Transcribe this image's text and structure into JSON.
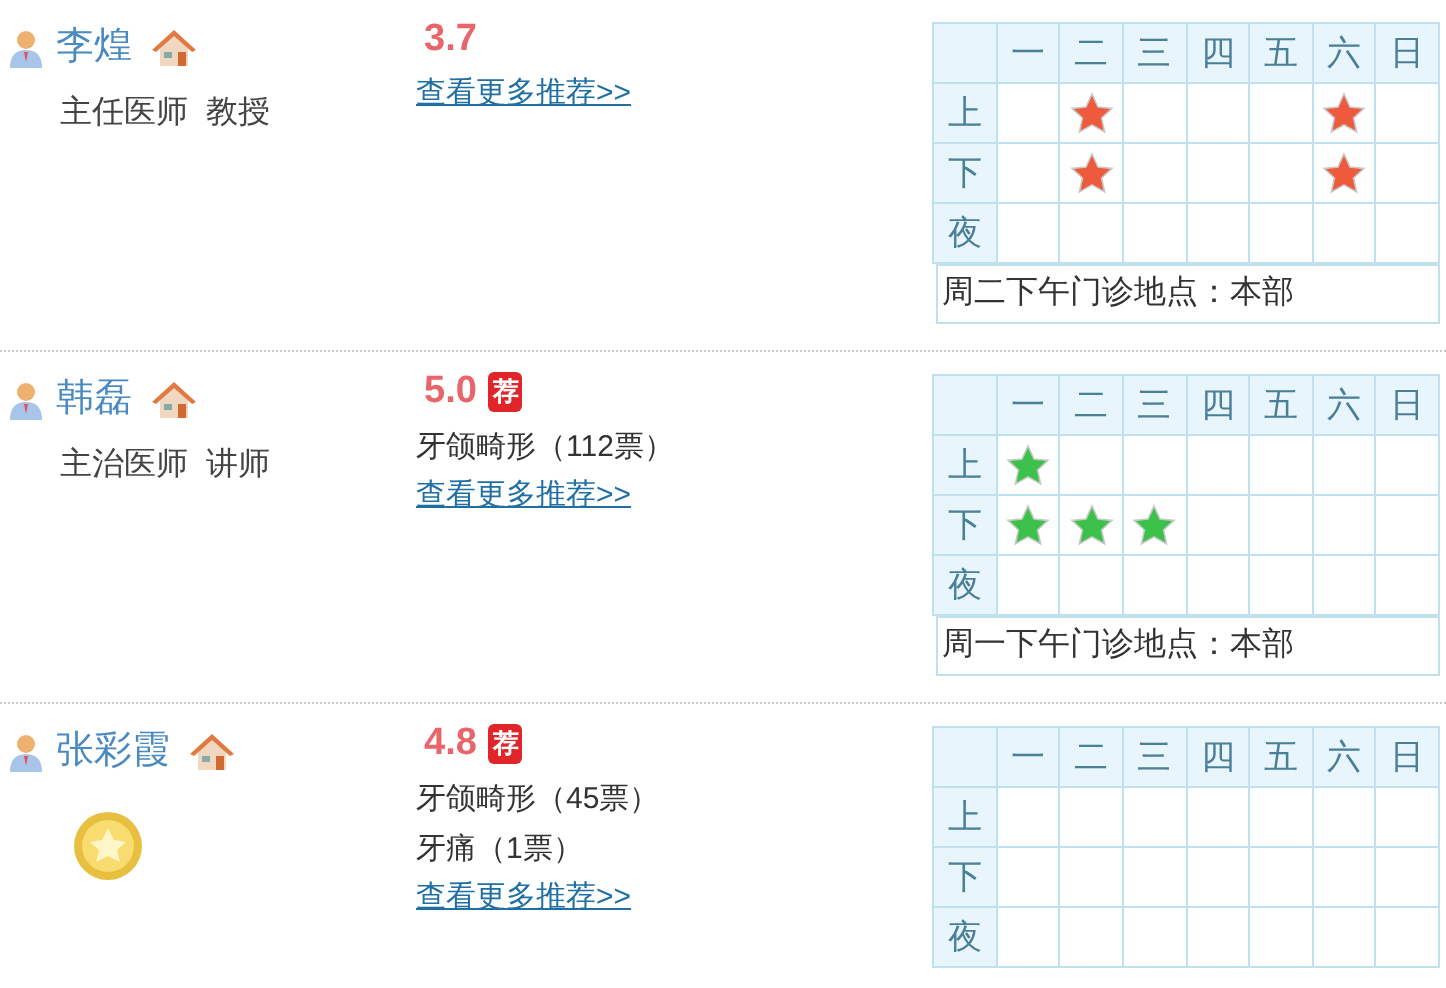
{
  "doctors": [
    {
      "name": "李煌",
      "title": "主任医师  教授",
      "score": "3.7",
      "link": "查看更多推荐>>",
      "schedule": {
        "days": [
          "一",
          "二",
          "三",
          "四",
          "五",
          "六",
          "日"
        ],
        "rows": [
          {
            "label": "上",
            "slots": [
              {
                "kind": "empty"
              },
              {
                "kind": "red-star"
              },
              {
                "kind": "empty"
              },
              {
                "kind": "empty"
              },
              {
                "kind": "empty"
              },
              {
                "kind": "red-star"
              },
              {
                "kind": "empty"
              }
            ]
          },
          {
            "label": "下",
            "slots": [
              {
                "kind": "empty"
              },
              {
                "kind": "red-star"
              },
              {
                "kind": "empty"
              },
              {
                "kind": "empty"
              },
              {
                "kind": "empty"
              },
              {
                "kind": "red-star"
              },
              {
                "kind": "empty"
              }
            ]
          },
          {
            "label": "夜",
            "slots": [
              {
                "kind": "empty"
              },
              {
                "kind": "empty"
              },
              {
                "kind": "empty"
              },
              {
                "kind": "empty"
              },
              {
                "kind": "empty"
              },
              {
                "kind": "empty"
              },
              {
                "kind": "empty"
              }
            ]
          }
        ],
        "note": "周二下午门诊地点：本部"
      }
    },
    {
      "name": "韩磊",
      "title": "主治医师  讲师",
      "score": "5.0",
      "tag": "荐",
      "votes": [
        "牙颌畸形（112票）"
      ],
      "link": "查看更多推荐>>",
      "schedule": {
        "days": [
          "一",
          "二",
          "三",
          "四",
          "五",
          "六",
          "日"
        ],
        "rows": [
          {
            "label": "上",
            "slots": [
              {
                "kind": "green-star"
              },
              {
                "kind": "empty"
              },
              {
                "kind": "empty"
              },
              {
                "kind": "empty"
              },
              {
                "kind": "empty"
              },
              {
                "kind": "empty"
              },
              {
                "kind": "empty"
              }
            ]
          },
          {
            "label": "下",
            "slots": [
              {
                "kind": "green-star"
              },
              {
                "kind": "green-star"
              },
              {
                "kind": "green-star"
              },
              {
                "kind": "empty"
              },
              {
                "kind": "empty"
              },
              {
                "kind": "empty"
              },
              {
                "kind": "empty"
              }
            ]
          },
          {
            "label": "夜",
            "slots": [
              {
                "kind": "empty"
              },
              {
                "kind": "empty"
              },
              {
                "kind": "empty"
              },
              {
                "kind": "empty"
              },
              {
                "kind": "empty"
              },
              {
                "kind": "empty"
              },
              {
                "kind": "empty"
              }
            ]
          }
        ],
        "note": "周一下午门诊地点：本部"
      }
    },
    {
      "name": "张彩霞",
      "medal": true,
      "score": "4.8",
      "tag": "荐",
      "votes": [
        "牙颌畸形（45票）",
        "牙痛（1票）"
      ],
      "link": "查看更多推荐>>",
      "schedule": {
        "days": [
          "一",
          "二",
          "三",
          "四",
          "五",
          "六",
          "日"
        ],
        "rows": [
          {
            "label": "上",
            "slots": [
              {
                "kind": "empty"
              },
              {
                "kind": "empty"
              },
              {
                "kind": "empty"
              },
              {
                "kind": "empty"
              },
              {
                "kind": "empty"
              },
              {
                "kind": "empty"
              },
              {
                "kind": "empty"
              }
            ]
          },
          {
            "label": "下",
            "slots": [
              {
                "kind": "empty"
              },
              {
                "kind": "empty"
              },
              {
                "kind": "empty"
              },
              {
                "kind": "empty"
              },
              {
                "kind": "empty"
              },
              {
                "kind": "empty"
              },
              {
                "kind": "empty"
              }
            ]
          },
          {
            "label": "夜",
            "slots": [
              {
                "kind": "empty"
              },
              {
                "kind": "empty"
              },
              {
                "kind": "empty"
              },
              {
                "kind": "empty"
              },
              {
                "kind": "empty"
              },
              {
                "kind": "empty"
              },
              {
                "kind": "empty"
              }
            ]
          }
        ]
      }
    }
  ]
}
